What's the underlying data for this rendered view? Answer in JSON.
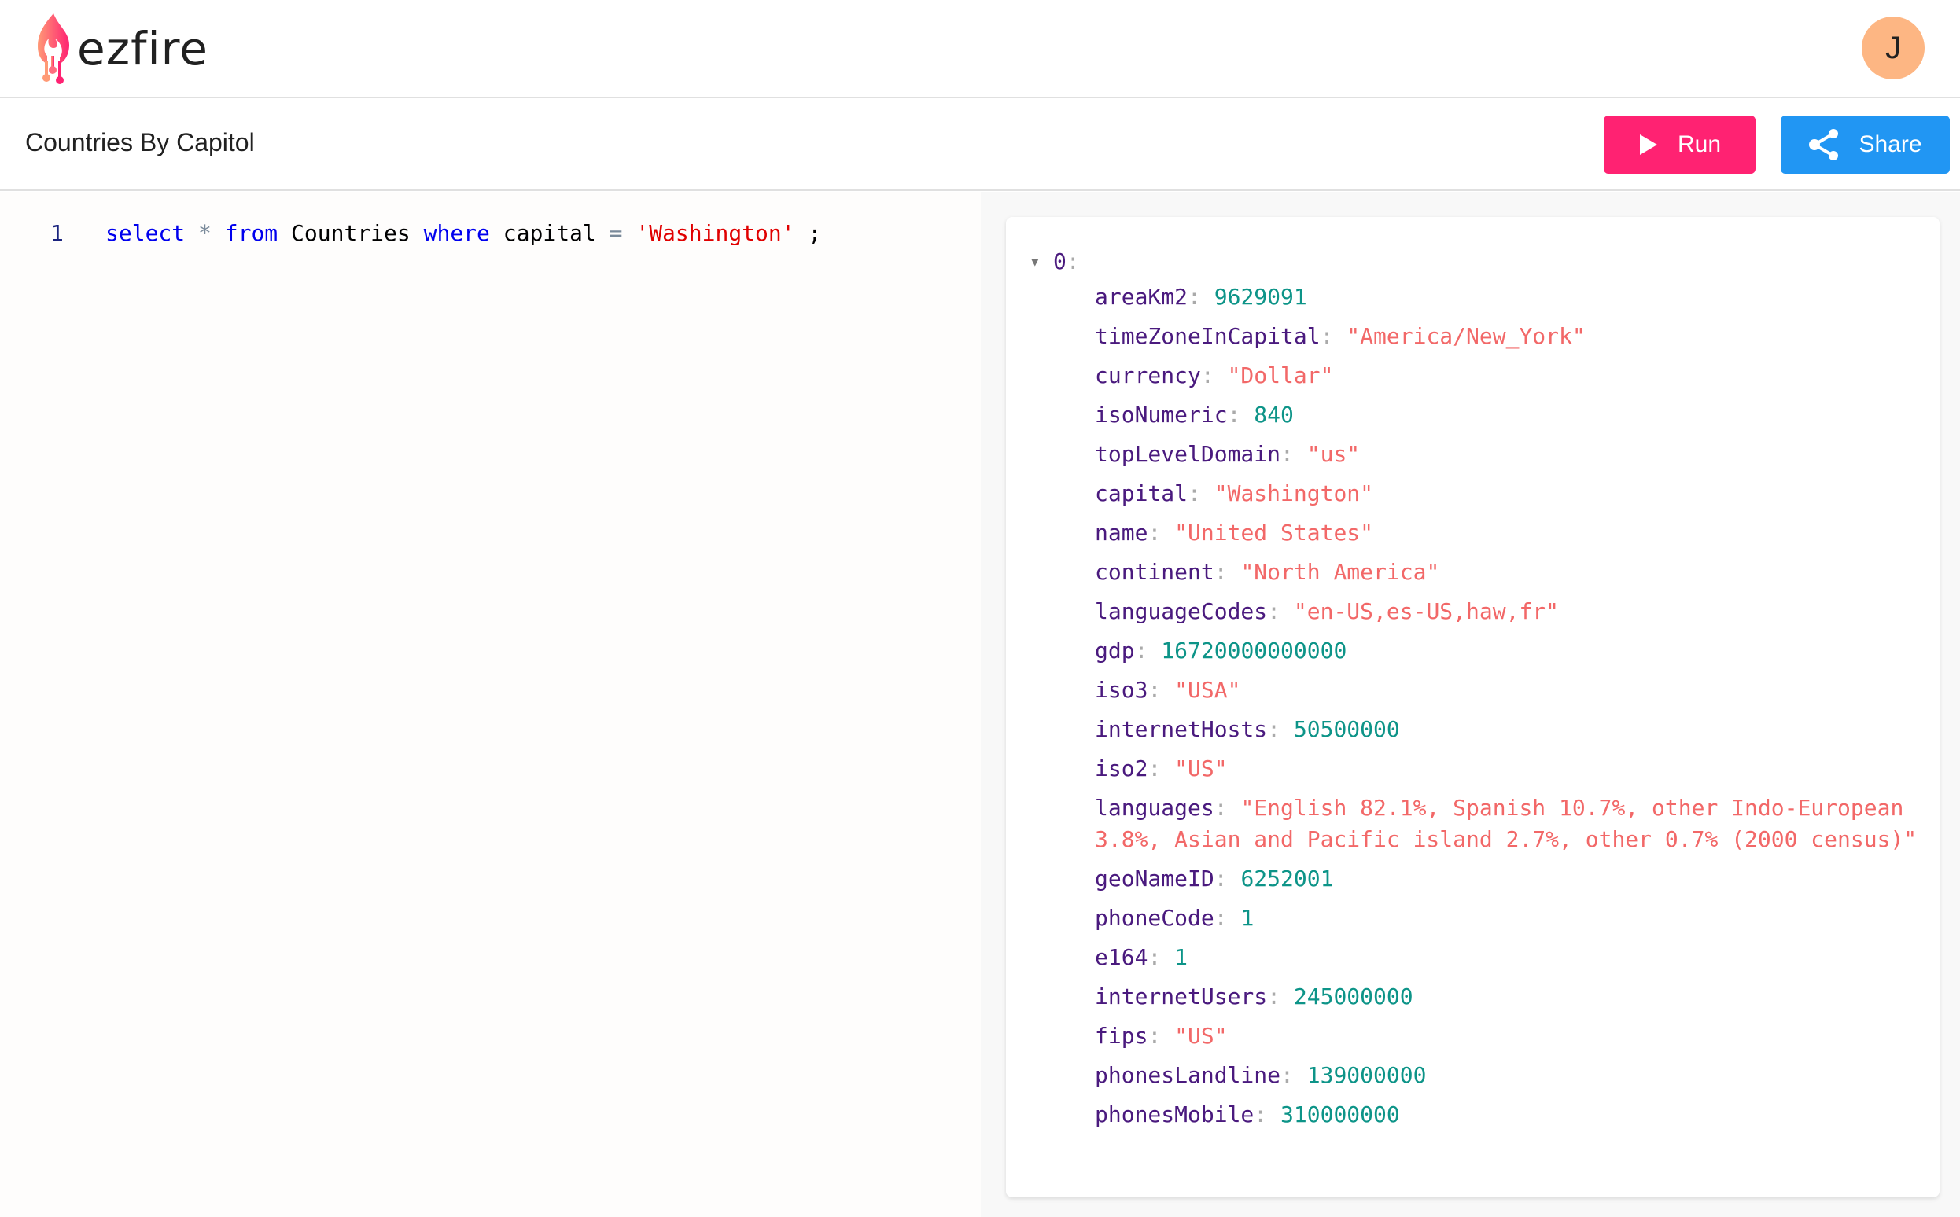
{
  "app": {
    "brand": "ezfire",
    "user_initial": "J",
    "colors": {
      "run": "#ff2272",
      "share": "#2196f3",
      "avatar": "#fdb683",
      "json_key": "#4a1a7e",
      "json_string": "#f26868",
      "json_number": "#0d9488"
    }
  },
  "toolbar": {
    "title": "Countries By Capitol",
    "run_label": "Run",
    "run_icon": "play-icon",
    "share_label": "Share",
    "share_icon": "share-icon"
  },
  "editor": {
    "lines": [
      {
        "number": "1",
        "tokens": [
          {
            "type": "kw",
            "text": "select"
          },
          {
            "type": "op",
            "text": " * "
          },
          {
            "type": "kw",
            "text": "from"
          },
          {
            "type": "plain",
            "text": " Countries "
          },
          {
            "type": "kw",
            "text": "where"
          },
          {
            "type": "plain",
            "text": " capital "
          },
          {
            "type": "op",
            "text": "="
          },
          {
            "type": "plain",
            "text": " "
          },
          {
            "type": "str",
            "text": "'Washington'"
          },
          {
            "type": "plain",
            "text": " ;"
          }
        ]
      }
    ]
  },
  "results": {
    "root_index": "0",
    "expanded": true,
    "fields": [
      {
        "key": "areaKm2",
        "value": "9629091",
        "type": "number"
      },
      {
        "key": "timeZoneInCapital",
        "value": "\"America/New_York\"",
        "type": "string"
      },
      {
        "key": "currency",
        "value": "\"Dollar\"",
        "type": "string"
      },
      {
        "key": "isoNumeric",
        "value": "840",
        "type": "number"
      },
      {
        "key": "topLevelDomain",
        "value": "\"us\"",
        "type": "string"
      },
      {
        "key": "capital",
        "value": "\"Washington\"",
        "type": "string"
      },
      {
        "key": "name",
        "value": "\"United States\"",
        "type": "string"
      },
      {
        "key": "continent",
        "value": "\"North America\"",
        "type": "string"
      },
      {
        "key": "languageCodes",
        "value": "\"en-US,es-US,haw,fr\"",
        "type": "string"
      },
      {
        "key": "gdp",
        "value": "16720000000000",
        "type": "number"
      },
      {
        "key": "iso3",
        "value": "\"USA\"",
        "type": "string"
      },
      {
        "key": "internetHosts",
        "value": "50500000",
        "type": "number"
      },
      {
        "key": "iso2",
        "value": "\"US\"",
        "type": "string"
      },
      {
        "key": "languages",
        "value": "\"English 82.1%, Spanish 10.7%, other Indo-European 3.8%, Asian and Pacific island 2.7%, other 0.7% (2000 census)\"",
        "type": "string"
      },
      {
        "key": "geoNameID",
        "value": "6252001",
        "type": "number"
      },
      {
        "key": "phoneCode",
        "value": "1",
        "type": "number"
      },
      {
        "key": "e164",
        "value": "1",
        "type": "number"
      },
      {
        "key": "internetUsers",
        "value": "245000000",
        "type": "number"
      },
      {
        "key": "fips",
        "value": "\"US\"",
        "type": "string"
      },
      {
        "key": "phonesLandline",
        "value": "139000000",
        "type": "number"
      },
      {
        "key": "phonesMobile",
        "value": "310000000",
        "type": "number"
      }
    ]
  }
}
